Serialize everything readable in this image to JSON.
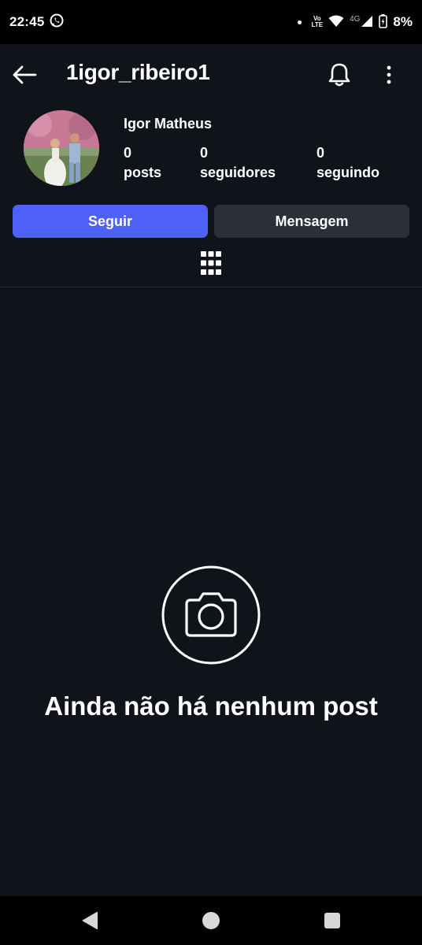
{
  "status_bar": {
    "time": "22:45",
    "volte_top": "Vo",
    "volte_bottom": "LTE",
    "network": "4G",
    "battery": "8%",
    "icons": [
      "whatsapp-icon",
      "notification-dot-icon",
      "volte-icon",
      "wifi-icon",
      "signal-icon",
      "battery-charging-icon"
    ]
  },
  "header": {
    "username": "1igor_ribeiro1",
    "icons": [
      "back-arrow-icon",
      "bell-icon",
      "more-vert-icon"
    ]
  },
  "profile": {
    "display_name": "Igor Matheus",
    "stats": [
      {
        "value": "0",
        "label": "posts"
      },
      {
        "value": "0",
        "label": "seguidores"
      },
      {
        "value": "0",
        "label": "seguindo"
      }
    ]
  },
  "actions": {
    "follow_label": "Seguir",
    "message_label": "Mensagem"
  },
  "tabs": {
    "grid_icon": "grid-icon"
  },
  "empty_state": {
    "icon": "camera-icon",
    "message": "Ainda não há nenhum post"
  },
  "nav_bar": {
    "icons": [
      "nav-back-icon",
      "nav-home-icon",
      "nav-recents-icon"
    ]
  },
  "colors": {
    "background": "#10131a",
    "accent": "#4e61f6",
    "secondary_button": "#2b2f37",
    "system_bar": "#000000"
  }
}
